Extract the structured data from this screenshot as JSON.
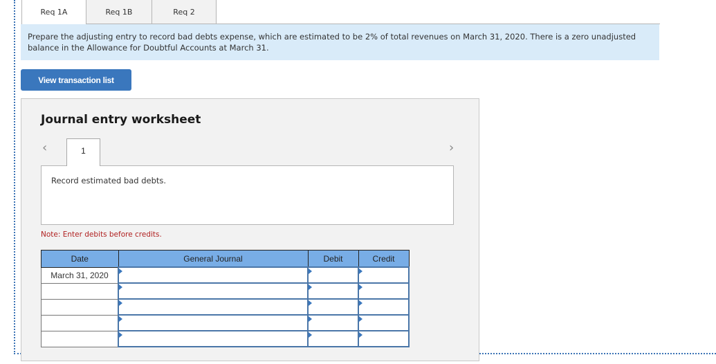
{
  "tabs": [
    {
      "label": "Req 1A",
      "active": true
    },
    {
      "label": "Req 1B",
      "active": false
    },
    {
      "label": "Req 2",
      "active": false
    }
  ],
  "prompt": "Prepare the adjusting entry to record bad debts expense, which are estimated to be 2% of total revenues on March 31, 2020. There is a zero unadjusted balance in the Allowance for Doubtful Accounts at March 31.",
  "view_transaction_button": "View transaction list",
  "worksheet": {
    "title": "Journal entry worksheet",
    "prev_icon": "chevron-left-icon",
    "next_icon": "chevron-right-icon",
    "entry_tab": "1",
    "description": "Record estimated bad debts.",
    "note": "Note: Enter debits before credits.",
    "table": {
      "headers": {
        "date": "Date",
        "general_journal": "General Journal",
        "debit": "Debit",
        "credit": "Credit"
      },
      "rows": [
        {
          "date": "March 31, 2020",
          "account": "",
          "debit": "",
          "credit": ""
        },
        {
          "date": "",
          "account": "",
          "debit": "",
          "credit": ""
        },
        {
          "date": "",
          "account": "",
          "debit": "",
          "credit": ""
        },
        {
          "date": "",
          "account": "",
          "debit": "",
          "credit": ""
        },
        {
          "date": "",
          "account": "",
          "debit": "",
          "credit": ""
        }
      ]
    }
  },
  "colors": {
    "accent_button": "#3a77bd",
    "prompt_bg": "#d9ebf9",
    "table_header": "#78ade6",
    "note_red": "#b02020",
    "input_border": "#4a76a8"
  }
}
